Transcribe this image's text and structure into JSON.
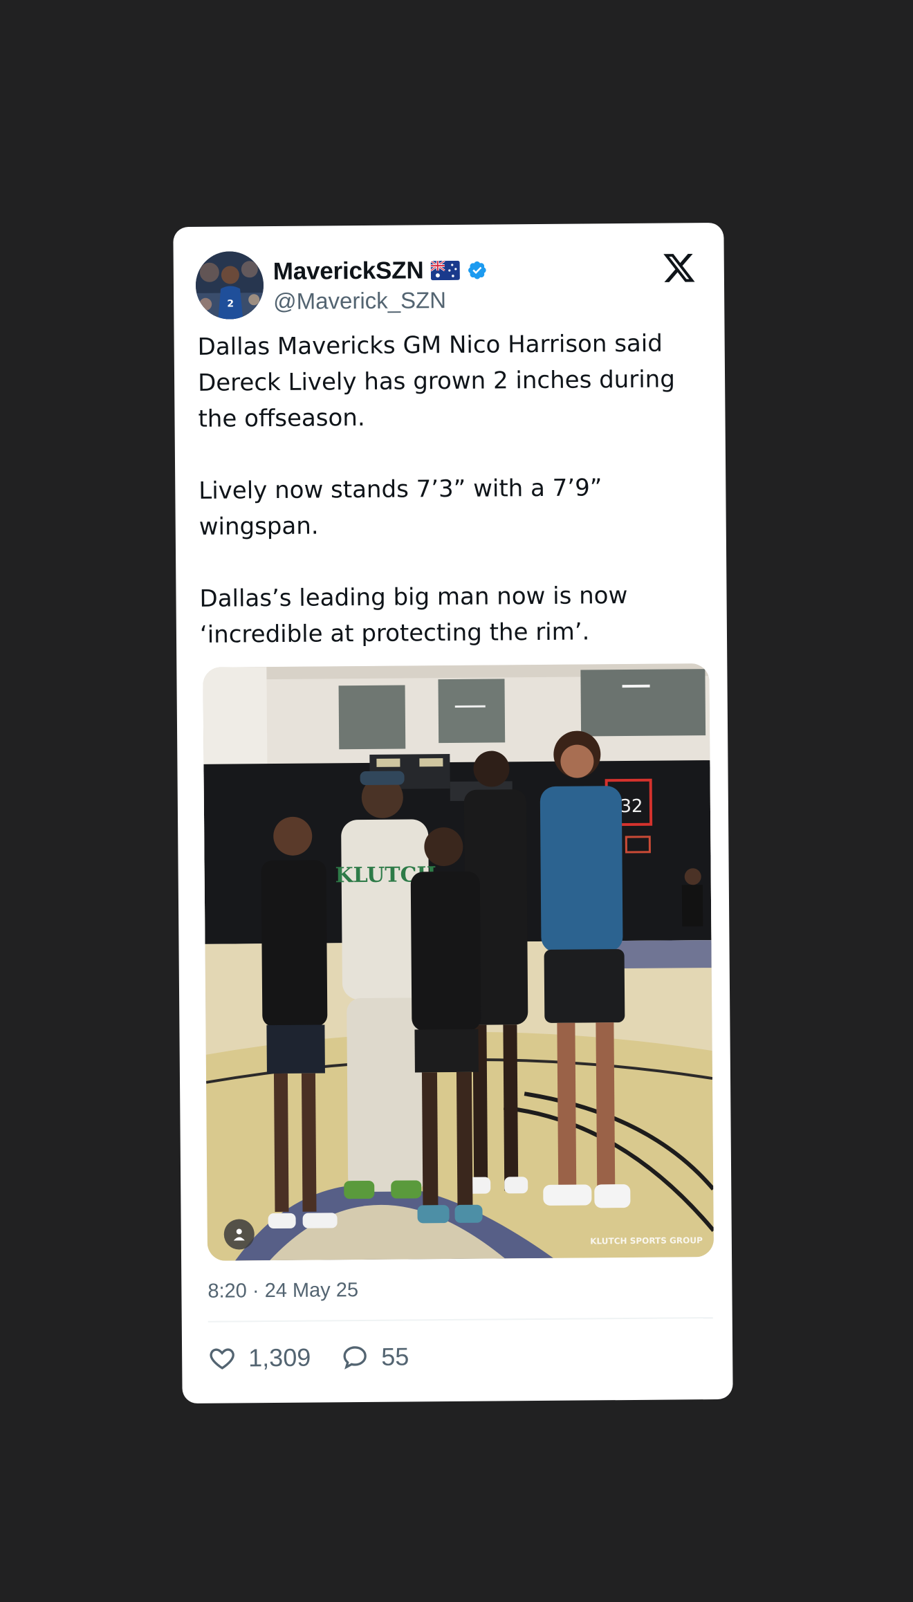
{
  "tweet": {
    "display_name": "MaverickSZN",
    "flag_icon": "australia-flag-icon",
    "verified_icon": "verified-badge-icon",
    "verified_color": "#1d9bf0",
    "handle": "@Maverick_SZN",
    "platform_icon": "x-logo-icon",
    "paragraphs": [
      "Dallas Mavericks GM Nico Harrison said Dereck Lively has grown 2 inches during the offseason.",
      "Lively now stands 7’3” with a 7’9” wingspan.",
      "Dallas’s leading big man now is now ‘incredible at protecting the rim’."
    ],
    "photo": {
      "watermark": "KLUTCH SPORTS GROUP",
      "hoodie_text": "KLUTCH",
      "scoreboard_number": "32",
      "alt_icon": "person-icon"
    },
    "timestamp": "8:20 · 24 May 25",
    "likes": "1,309",
    "replies": "55",
    "like_icon": "heart-icon",
    "reply_icon": "reply-bubble-icon"
  },
  "colors": {
    "background": "#212122",
    "card": "#ffffff",
    "text": "#0f1419",
    "secondary_text": "#536471"
  }
}
